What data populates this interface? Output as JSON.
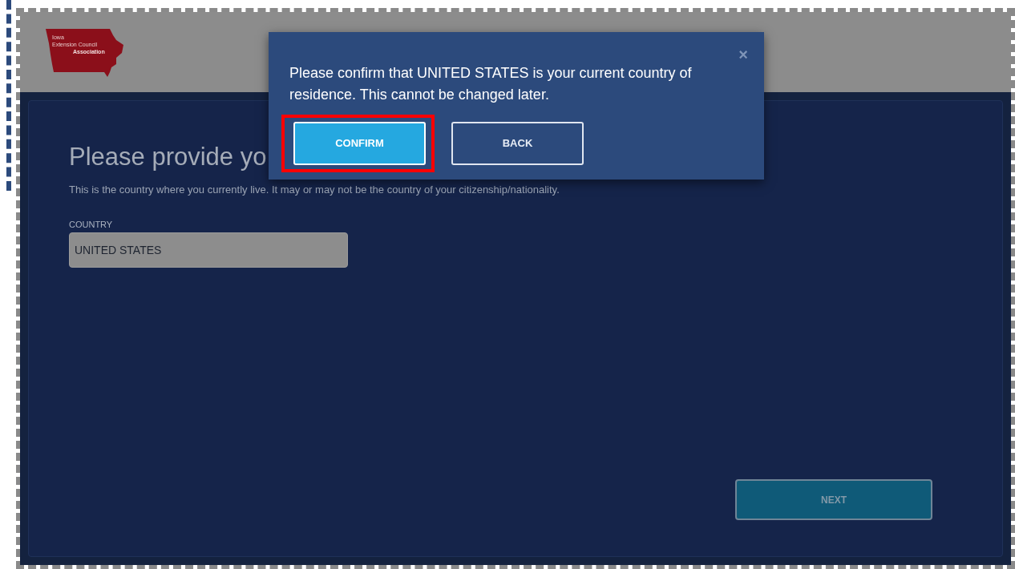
{
  "logo": {
    "lines": [
      "Iowa",
      "Extension Council",
      "Association"
    ]
  },
  "heading": "Please provide yo",
  "subtitle": "This is the country where you currently live. It may or may not be the country of your citizenship/nationality.",
  "country_field": {
    "label": "COUNTRY",
    "value": "UNITED STATES",
    "disabled": true
  },
  "next_button": {
    "label": "NEXT",
    "disabled": true
  },
  "dialog": {
    "close": "×",
    "message": "Please confirm that UNITED STATES is your current country of residence. This cannot be changed later.",
    "buttons": [
      {
        "label": "CONFIRM",
        "kind": "primary",
        "highlighted": true
      },
      {
        "label": "BACK",
        "kind": "outline",
        "highlighted": false
      }
    ]
  }
}
